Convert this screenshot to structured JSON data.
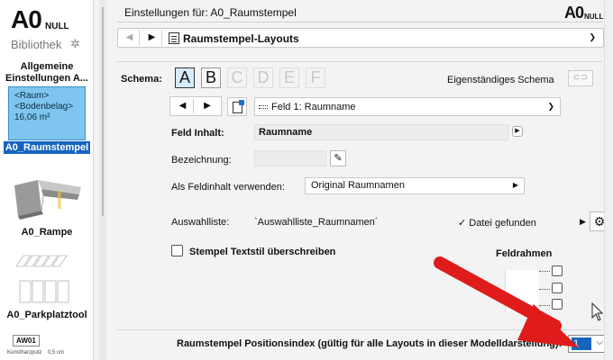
{
  "sidebar": {
    "logo_main": "A0",
    "logo_sub": "NULL",
    "logo_lib": "Bibliothek",
    "items": [
      {
        "label": "Allgemeine Einstellungen A..."
      },
      {
        "label": "A0_Raumstempel",
        "selected": true,
        "preview_lines": [
          "<Raum>",
          "<Bodenbelag>",
          "16,06 m²"
        ]
      },
      {
        "label": "A0_Rampe"
      },
      {
        "label": "A0_Parkplatztool"
      },
      {
        "label": "AW01",
        "caption_left": "Kunstharzputz",
        "caption_right": "0,5 cm"
      }
    ]
  },
  "header": {
    "title": "Einstellungen für: A0_Raumstempel",
    "logo_main": "A0",
    "logo_sub": "NULL"
  },
  "layout": {
    "current": "Raumstempel-Layouts"
  },
  "schema": {
    "label": "Schema:",
    "options": [
      "A",
      "B",
      "C",
      "D",
      "E",
      "F"
    ],
    "selected": "A",
    "eigen_label": "Eigenständiges Schema"
  },
  "feld": {
    "current": "Feld 1: Raumname",
    "inhalt_label": "Feld Inhalt:",
    "inhalt_value": "Raumname",
    "bezeichnung_label": "Bezeichnung:",
    "bezeichnung_value": "",
    "verwenden_label": "Als Feldinhalt verwenden:",
    "verwenden_value": "Original Raumnamen",
    "auswahl_label": "Auswahlliste:",
    "auswahl_value": "`Auswahlliste_Raumnamen´",
    "datei_status": "✓ Datei gefunden"
  },
  "textstil": {
    "label": "Stempel Textstil überschreiben",
    "checked": false
  },
  "feldrahmen": {
    "label": "Feldrahmen"
  },
  "position": {
    "label": "Raumstempel Positionsindex (gültig für alle Layouts in dieser Modelldarstellung):",
    "value": "1"
  },
  "colors": {
    "accent": "#1565c0",
    "selection_preview": "#7ec6f0",
    "annotation_arrow": "#e01b1b"
  }
}
